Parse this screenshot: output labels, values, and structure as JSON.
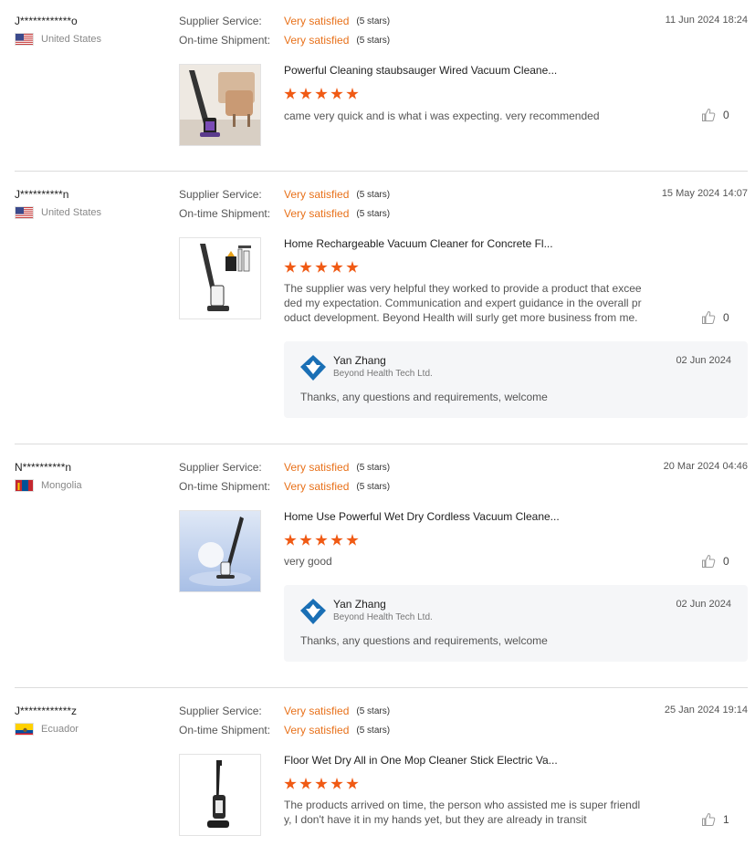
{
  "labels": {
    "supplier_service": "Supplier Service:",
    "ontime_shipment": "On-time Shipment:"
  },
  "reviews": [
    {
      "buyer": "J************o",
      "country": "United States",
      "flag": "us-flag",
      "date": "11 Jun 2024 18:24",
      "supplier_service": {
        "value": "Very satisfied",
        "stars": "(5 stars)"
      },
      "ontime_shipment": {
        "value": "Very satisfied",
        "stars": "(5 stars)"
      },
      "product_title": "Powerful Cleaning staubsauger Wired Vacuum Cleane...",
      "product_thumb": "vacuum-cleaner-living-room-image",
      "rating": 5,
      "comment": "came very quick and is what i was expecting. very recommended",
      "likes": "0"
    },
    {
      "buyer": "J**********n",
      "country": "United States",
      "flag": "us-flag",
      "date": "15 May 2024 14:07",
      "supplier_service": {
        "value": "Very satisfied",
        "stars": "(5 stars)"
      },
      "ontime_shipment": {
        "value": "Very satisfied",
        "stars": "(5 stars)"
      },
      "product_title": "Home Rechargeable Vacuum Cleaner for Concrete Fl...",
      "product_thumb": "cordless-vacuum-with-accessories-image",
      "rating": 5,
      "comment_lines": [
        "The supplier was very helpful they worked to provide a product that excee",
        "ded my expectation. Communication and expert guidance in the overall pr",
        "oduct development. Beyond Health will surly get more business from me."
      ],
      "likes": "0",
      "reply": {
        "name": "Yan Zhang",
        "company": "Beyond Health Tech Ltd.",
        "date": "02 Jun 2024",
        "text": "Thanks, any questions and requirements, welcome"
      }
    },
    {
      "buyer": "N**********n",
      "country": "Mongolia",
      "flag": "mongolia-flag",
      "date": "20 Mar 2024 04:46",
      "supplier_service": {
        "value": "Very satisfied",
        "stars": "(5 stars)"
      },
      "ontime_shipment": {
        "value": "Very satisfied",
        "stars": "(5 stars)"
      },
      "product_title": "Home Use Powerful Wet Dry Cordless Vacuum Cleane...",
      "product_thumb": "wet-dry-vacuum-blue-background-image",
      "rating": 5,
      "comment": "very good",
      "likes": "0",
      "reply": {
        "name": "Yan Zhang",
        "company": "Beyond Health Tech Ltd.",
        "date": "02 Jun 2024",
        "text": "Thanks, any questions and requirements, welcome"
      }
    },
    {
      "buyer": "J************z",
      "country": "Ecuador",
      "flag": "ecuador-flag",
      "date": "25 Jan 2024 19:14",
      "supplier_service": {
        "value": "Very satisfied",
        "stars": "(5 stars)"
      },
      "ontime_shipment": {
        "value": "Very satisfied",
        "stars": "(5 stars)"
      },
      "product_title": "Floor Wet Dry All in One Mop Cleaner Stick Electric Va...",
      "product_thumb": "mop-cleaner-stick-image",
      "rating": 5,
      "comment_lines": [
        "The products arrived on time, the person who assisted me is super friendl",
        "y, I don't have it in my hands yet, but they are already in transit"
      ],
      "likes": "1"
    }
  ],
  "colors": {
    "accent": "#e8711a",
    "star": "#f05a14",
    "reply_bg": "#f5f6f8",
    "logo_blue": "#1a6fb5"
  }
}
